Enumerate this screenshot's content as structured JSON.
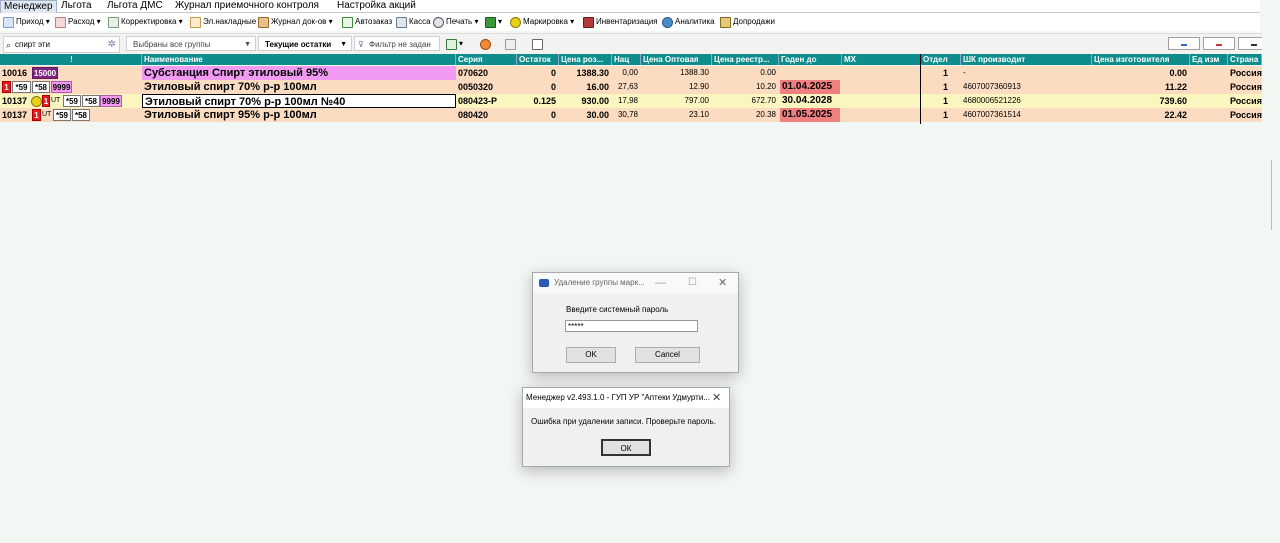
{
  "menu": [
    "Менеджер",
    "Льгота",
    "Льгота ДМС",
    "Журнал приемочного контроля",
    "Настройка акций"
  ],
  "toolbar": [
    "Приход",
    "Расход",
    "Корректировка",
    "Эл.накладные",
    "Журнал док-ов",
    "Автозаказ",
    "Касса",
    "Печать",
    "Маркировка",
    "Инвентаризация",
    "Аналитика",
    "Допродажи"
  ],
  "filters": {
    "search_value": "спирт эти",
    "groups": "Выбраны все группы",
    "stock": "Текущие остатки",
    "filter": "Фильтр не задан"
  },
  "columns": [
    "!",
    "Наименование",
    "Серия",
    "Остаток",
    "Цена роз...",
    "Нац",
    "Цена Оптовая",
    "Цена реестр...",
    "Годен до",
    "МХ",
    "Отдел",
    "ШК производит",
    "Цена изготовителя",
    "Ед изм",
    "Страна"
  ],
  "rows": [
    {
      "id": "10016",
      "b1": "15000",
      "name": "Субстанция Спирт этиловый 95%",
      "series": "070620",
      "stock": "0",
      "retail": "1388.30",
      "markup": "0,00",
      "wholesale": "1388.30",
      "registry": "0.00",
      "expiry": "",
      "dept": "1",
      "barcode": "-",
      "mprice": "0.00",
      "country": "Россия"
    },
    {
      "id": "1",
      "b1": "*59",
      "b2": "*58",
      "b3": "9999",
      "name": "Этиловый спирт 70% р-р 100мл",
      "series": "0050320",
      "stock": "0",
      "retail": "16.00",
      "markup": "27,63",
      "wholesale": "12.90",
      "registry": "10.20",
      "expiry": "01.04.2025",
      "dept": "1",
      "barcode": "4607007360913",
      "mprice": "11.22",
      "country": "Россия"
    },
    {
      "id": "10137",
      "b0": "1",
      "b1": "UT",
      "b2": "*59",
      "b3": "*58",
      "b4": "9999",
      "name": "Этиловый спирт 70% р-р 100мл №40",
      "series": "080423-Р",
      "stock": "0.125",
      "retail": "930.00",
      "markup": "17,98",
      "wholesale": "797.00",
      "registry": "672.70",
      "expiry": "30.04.2028",
      "dept": "1",
      "barcode": "4680006521226",
      "mprice": "739.60",
      "country": "Россия"
    },
    {
      "id": "10137",
      "b0": "1",
      "b1": "UT",
      "b2": "*59",
      "b3": "*58",
      "name": "Этиловый спирт 95% р-р 100мл",
      "series": "080420",
      "stock": "0",
      "retail": "30.00",
      "markup": "30,78",
      "wholesale": "23.10",
      "registry": "20.38",
      "expiry": "01.05.2025",
      "dept": "1",
      "barcode": "4607007361514",
      "mprice": "22.42",
      "country": "Россия"
    }
  ],
  "dialog1": {
    "title": "Удаление группы марк...",
    "prompt": "Введите системный пароль",
    "password": "*****",
    "ok": "OK",
    "cancel": "Cancel"
  },
  "dialog2": {
    "title": "Менеджер v2.493.1.0 - ГУП УР \"Аптеки Удмурти...",
    "message": "Ошибка при удалении записи. Проверьте пароль.",
    "ok": "ОК"
  },
  "colors": {
    "header": "#0f8c8c",
    "row_pink": "#f29af2",
    "row_peach": "#fbdcc0",
    "row_yellow": "#fbf5c0",
    "date_red": "#f08080"
  }
}
